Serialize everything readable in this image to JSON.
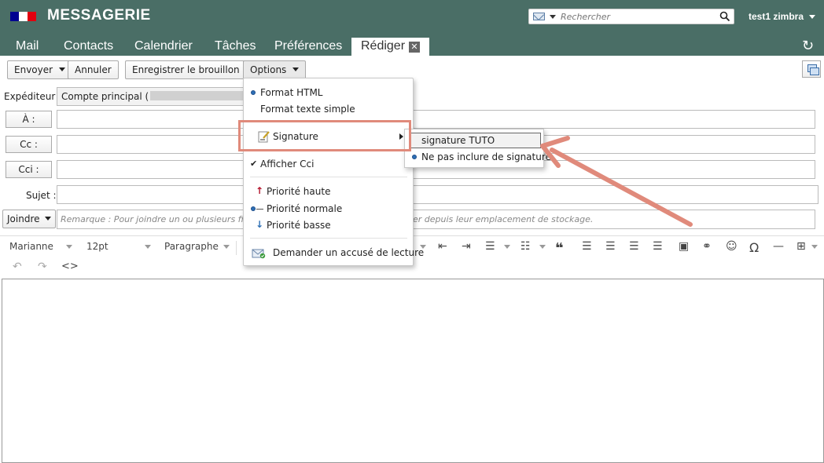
{
  "app": {
    "title": "MESSAGERIE",
    "flag_colors": [
      "#000091",
      "#ffffff",
      "#e1000f"
    ],
    "header_color": "#4a6e66",
    "accent_color": "#e08a7b"
  },
  "search": {
    "placeholder": "Rechercher",
    "icon": "mail-icon",
    "button_icon": "search-icon"
  },
  "user": {
    "name": "test1 zimbra"
  },
  "tabs": [
    {
      "label": "Mail"
    },
    {
      "label": "Contacts"
    },
    {
      "label": "Calendrier"
    },
    {
      "label": "Tâches"
    },
    {
      "label": "Préférences"
    },
    {
      "label": "Rédiger",
      "active": true,
      "close": "✕"
    }
  ],
  "toolbar": {
    "send": "Envoyer",
    "cancel": "Annuler",
    "save_draft": "Enregistrer le brouillon",
    "options": "Options"
  },
  "compose": {
    "sender_label": "Expéditeur :",
    "sender_value": "Compte principal (",
    "sender_at": "@",
    "to_label": "À :",
    "cc_label": "Cc :",
    "bcc_label": "Cci :",
    "subject_label": "Sujet :",
    "attach_label": "Joindre",
    "attach_remark_a": "Remarque : Pour joindre un ou plusieurs fichi",
    "attach_remark_b": "er depuis leur emplacement de stockage."
  },
  "editor": {
    "font": "Marianne",
    "size": "12pt",
    "block": "Paragraphe"
  },
  "options_menu": {
    "items": [
      {
        "label": "Format HTML",
        "selected": true
      },
      {
        "label": "Format texte simple"
      },
      {
        "label": "Signature",
        "icon": "signature-icon",
        "submenu": true
      },
      {
        "label": "Afficher Cci",
        "checked": true
      },
      {
        "label": "Priorité haute",
        "icon": "arrow-up-icon"
      },
      {
        "label": "Priorité normale",
        "icon": "priority-normal-icon"
      },
      {
        "label": "Priorité basse",
        "icon": "arrow-down-icon"
      },
      {
        "label": "Demander un accusé de lecture",
        "icon": "read-receipt-icon"
      }
    ]
  },
  "signature_submenu": {
    "items": [
      {
        "label": "signature TUTO",
        "highlighted": true
      },
      {
        "label": "Ne pas inclure de signature",
        "selected": true
      }
    ]
  }
}
